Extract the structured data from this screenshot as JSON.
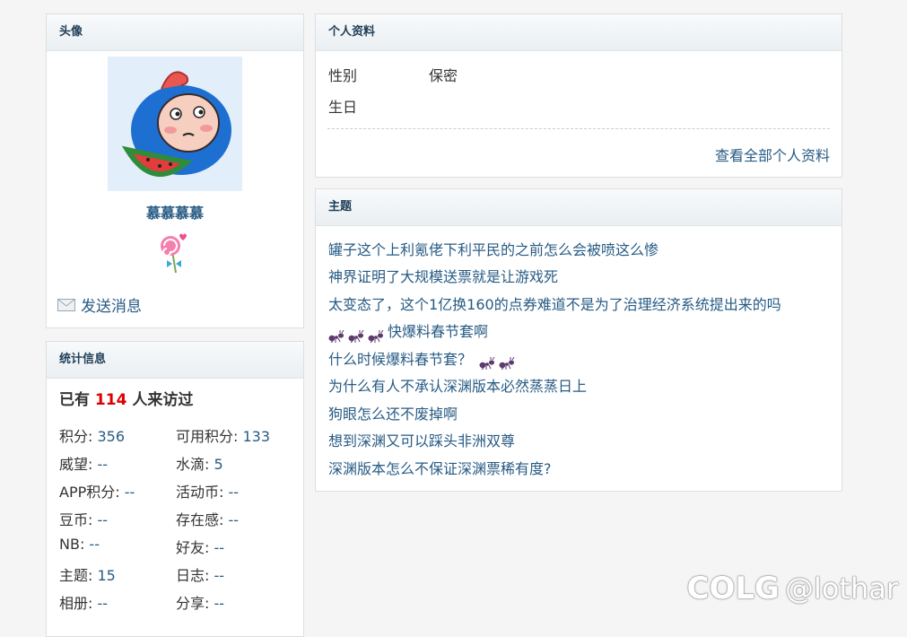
{
  "avatar_panel": {
    "title": "头像",
    "username": "慕慕慕慕",
    "send_message": "发送消息"
  },
  "stats_panel": {
    "title": "统计信息",
    "visits_prefix": "已有",
    "visits_count": "114",
    "visits_suffix": "人来访过",
    "rows": [
      [
        {
          "label": "积分: ",
          "value": "356"
        },
        {
          "label": "可用积分: ",
          "value": "133"
        }
      ],
      [
        {
          "label": "威望: ",
          "value": "--"
        },
        {
          "label": "水滴: ",
          "value": "5"
        }
      ],
      [
        {
          "label": "APP积分: ",
          "value": "--"
        },
        {
          "label": "活动币: ",
          "value": "--"
        }
      ],
      [
        {
          "label": "豆币: ",
          "value": "--"
        },
        {
          "label": "存在感: ",
          "value": "--"
        }
      ],
      [
        {
          "label": "NB: ",
          "value": "--"
        },
        {
          "label": "好友: ",
          "value": "--"
        }
      ],
      [
        {
          "label": "主题: ",
          "value": "15"
        },
        {
          "label": "日志: ",
          "value": "--"
        }
      ],
      [
        {
          "label": "相册: ",
          "value": "--"
        },
        {
          "label": "分享: ",
          "value": "--"
        }
      ]
    ]
  },
  "profile_panel": {
    "title": "个人资料",
    "gender_label": "性别",
    "gender_value": "保密",
    "birthday_label": "生日",
    "view_all": "查看全部个人资料"
  },
  "topics_panel": {
    "title": "主题",
    "items": [
      {
        "pre_ants": 0,
        "text": "罐子这个上利氪佬下利平民的之前怎么会被喷这么惨",
        "post_ants": 0
      },
      {
        "pre_ants": 0,
        "text": "神界证明了大规模送票就是让游戏死",
        "post_ants": 0
      },
      {
        "pre_ants": 0,
        "text": "太变态了，这个1亿换160的点券难道不是为了治理经济系统提出来的吗",
        "post_ants": 0
      },
      {
        "pre_ants": 3,
        "text": "快爆料春节套啊",
        "post_ants": 0
      },
      {
        "pre_ants": 0,
        "text": "什么时候爆料春节套？",
        "post_ants": 2
      },
      {
        "pre_ants": 0,
        "text": "为什么有人不承认深渊版本必然蒸蒸日上",
        "post_ants": 0
      },
      {
        "pre_ants": 0,
        "text": "狗眼怎么还不废掉啊",
        "post_ants": 0
      },
      {
        "pre_ants": 0,
        "text": "想到深渊又可以踩头非洲双尊",
        "post_ants": 0
      },
      {
        "pre_ants": 0,
        "text": "深渊版本怎么不保证深渊票稀有度?",
        "post_ants": 0
      }
    ]
  },
  "watermark": {
    "logo": "COLG",
    "handle": "@lothar"
  },
  "colors": {
    "link": "#275b84",
    "visits_count": "#dd0000",
    "panel_head_text": "#1d3d57"
  }
}
